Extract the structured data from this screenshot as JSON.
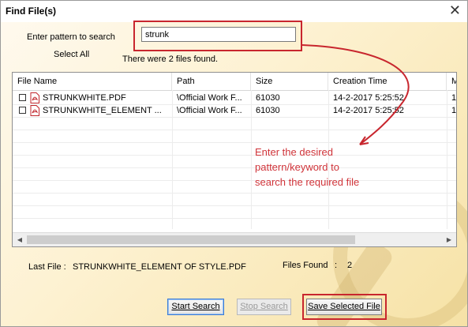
{
  "window": {
    "title": "Find File(s)"
  },
  "search": {
    "label": "Enter pattern to search",
    "value": "strunk",
    "select_all": "Select All",
    "status": "There were 2 files found."
  },
  "table": {
    "columns": [
      "File Name",
      "Path",
      "Size",
      "Creation Time",
      "M"
    ],
    "rows": [
      {
        "name": "STRUNKWHITE.PDF",
        "path": "\\Official Work F...",
        "size": "61030",
        "created": "14-2-2017 5:25:52",
        "more": "1"
      },
      {
        "name": "STRUNKWHITE_ELEMENT ...",
        "path": "\\Official Work F...",
        "size": "61030",
        "created": "14-2-2017 5:25:52",
        "more": "1"
      }
    ]
  },
  "annotation": {
    "lines": [
      "Enter the desired",
      "pattern/keyword to",
      "search the required file"
    ]
  },
  "footer": {
    "last_file_label": "Last File :",
    "last_file_value": "STRUNKWHITE_ELEMENT OF STYLE.PDF",
    "files_found_label": "Files Found",
    "files_found_sep": ":",
    "files_found_value": "2"
  },
  "buttons": {
    "start": "Start Search",
    "stop": "Stop Search",
    "save": "Save Selected File"
  },
  "colors": {
    "annotation_red": "#c8262e",
    "pdf_red": "#c0272d"
  }
}
